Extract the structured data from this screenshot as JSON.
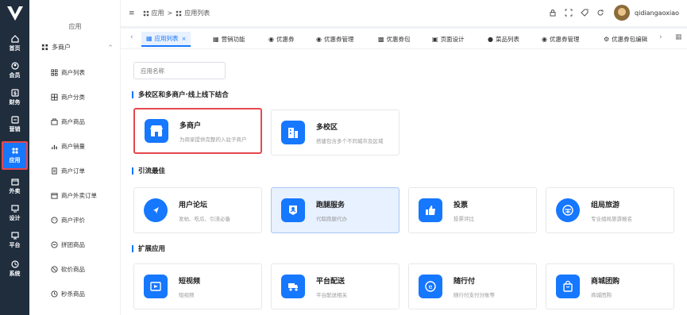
{
  "rail": {
    "items": [
      {
        "label": "首页",
        "icon": "home-icon"
      },
      {
        "label": "会员",
        "icon": "user-icon"
      },
      {
        "label": "财务",
        "icon": "finance-icon"
      },
      {
        "label": "营销",
        "icon": "marketing-icon"
      },
      {
        "label": "应用",
        "icon": "apps-icon",
        "active": true
      },
      {
        "label": "外卖",
        "icon": "takeout-icon"
      },
      {
        "label": "设计",
        "icon": "design-icon"
      },
      {
        "label": "平台",
        "icon": "platform-icon"
      },
      {
        "label": "系统",
        "icon": "system-icon"
      }
    ]
  },
  "sidebar": {
    "section_title": "应用",
    "group_label": "多商户",
    "group_chevron": "^",
    "items": [
      {
        "label": "商户列表"
      },
      {
        "label": "商户分类"
      },
      {
        "label": "商户商品"
      },
      {
        "label": "商户销量"
      },
      {
        "label": "商户订单"
      },
      {
        "label": "商户外卖订单"
      },
      {
        "label": "商户评价"
      },
      {
        "label": "拼团商品"
      },
      {
        "label": "砍价商品"
      },
      {
        "label": "秒杀商品"
      }
    ]
  },
  "header": {
    "breadcrumb": [
      "应用",
      "应用列表"
    ],
    "separator": ">",
    "username": "qidiangaoxiao"
  },
  "tabs": [
    {
      "label": "应用列表",
      "active": true,
      "closable": true
    },
    {
      "label": "营销功能"
    },
    {
      "label": "优惠券"
    },
    {
      "label": "优惠券管理"
    },
    {
      "label": "优惠券包"
    },
    {
      "label": "页面设计"
    },
    {
      "label": "菜品列表"
    },
    {
      "label": "优惠券管理"
    },
    {
      "label": "优惠券包编辑"
    }
  ],
  "main": {
    "search_placeholder": "应用名称",
    "sections": [
      {
        "title": "多校区和多商户·线上线下结合",
        "cards": [
          {
            "name": "多商户",
            "desc": "为商家提供完整的入驻子商户",
            "icon": "shop-icon",
            "highlight": true
          },
          {
            "name": "多校区",
            "desc": "搭建包含多个不同城市及区域",
            "icon": "building-icon"
          }
        ]
      },
      {
        "title": "引流最佳",
        "cards": [
          {
            "name": "用户论坛",
            "desc": "发帖、吃瓜、引流必备",
            "icon": "forum-icon"
          },
          {
            "name": "跑腿服务",
            "desc": "代取跑腿代办",
            "icon": "errand-icon",
            "selected": true
          },
          {
            "name": "投票",
            "desc": "投票评比",
            "icon": "vote-icon"
          },
          {
            "name": "组局旅游",
            "desc": "专业组局旅游报名",
            "icon": "travel-icon"
          }
        ]
      },
      {
        "title": "扩展应用",
        "cards": [
          {
            "name": "短视频",
            "desc": "短视频",
            "icon": "video-icon"
          },
          {
            "name": "平台配送",
            "desc": "平台配送相关",
            "icon": "delivery-icon"
          },
          {
            "name": "随行付",
            "desc": "随行付支付分账等",
            "icon": "pay-icon"
          },
          {
            "name": "商城团购",
            "desc": "商城团购",
            "icon": "mall-icon"
          }
        ]
      }
    ]
  },
  "colors": {
    "accent": "#1677ff",
    "rail_bg": "#1f2d3d",
    "highlight": "#e5484d"
  }
}
